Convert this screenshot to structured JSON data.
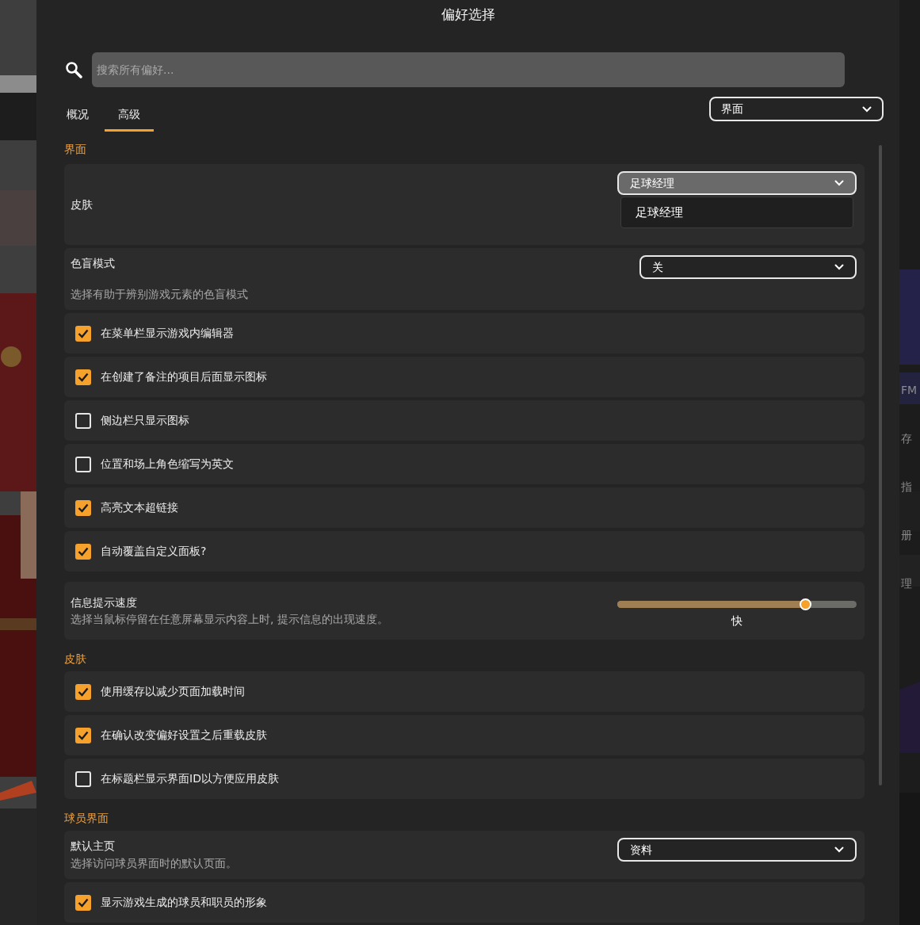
{
  "window": {
    "title": "偏好选择"
  },
  "search": {
    "placeholder": "搜索所有偏好..."
  },
  "tabs": [
    {
      "label": "概况",
      "selected": false
    },
    {
      "label": "高级",
      "selected": true
    }
  ],
  "category_dropdown": {
    "value": "界面"
  },
  "sections": [
    {
      "title": "界面",
      "items": [
        {
          "kind": "select",
          "label": "皮肤",
          "value": "足球经理",
          "open": true,
          "options": [
            "足球经理"
          ]
        },
        {
          "kind": "select",
          "label": "色盲模式",
          "description": "选择有助于辨别游戏元素的色盲模式",
          "value": "关",
          "open": false
        },
        {
          "kind": "checkbox",
          "label": "在菜单栏显示游戏内编辑器",
          "checked": true
        },
        {
          "kind": "checkbox",
          "label": "在创建了备注的项目后面显示图标",
          "checked": true
        },
        {
          "kind": "checkbox",
          "label": "侧边栏只显示图标",
          "checked": false
        },
        {
          "kind": "checkbox",
          "label": "位置和场上角色缩写为英文",
          "checked": false
        },
        {
          "kind": "checkbox",
          "label": "高亮文本超链接",
          "checked": true
        },
        {
          "kind": "checkbox",
          "label": "自动覆盖自定义面板?",
          "checked": true
        },
        {
          "kind": "slider",
          "label": "信息提示速度",
          "description": "选择当鼠标停留在任意屏幕显示内容上时, 提示信息的出现速度。",
          "level": 0.785,
          "reading": "快"
        }
      ]
    },
    {
      "title": "皮肤",
      "items": [
        {
          "kind": "checkbox",
          "label": "使用缓存以减少页面加载时间",
          "checked": true
        },
        {
          "kind": "checkbox",
          "label": "在确认改变偏好设置之后重载皮肤",
          "checked": true
        },
        {
          "kind": "checkbox",
          "label": "在标题栏显示界面ID以方便应用皮肤",
          "checked": false
        }
      ]
    },
    {
      "title": "球员界面",
      "items": [
        {
          "kind": "select",
          "label": "默认主页",
          "description": "选择访问球员界面时的默认页面。",
          "value": "资料",
          "open": false
        },
        {
          "kind": "checkbox",
          "label": "显示游戏生成的球员和职员的形象",
          "checked": true
        }
      ]
    }
  ],
  "background_texts": [
    "FM",
    "存",
    "指",
    "册",
    "理"
  ]
}
